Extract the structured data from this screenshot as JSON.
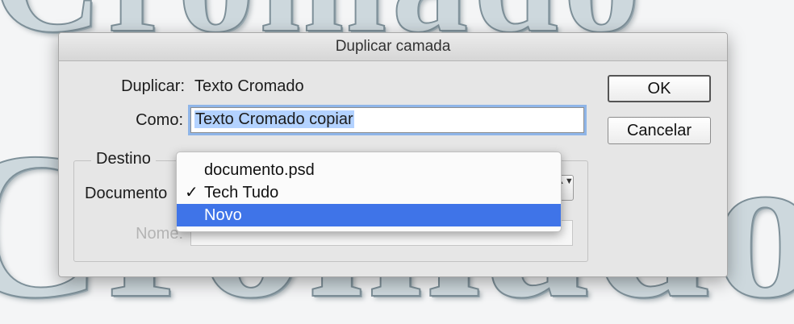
{
  "background": {
    "word_top": "Cromado",
    "word_bottom": "Cromado"
  },
  "dialog": {
    "title": "Duplicar camada",
    "duplicar_label": "Duplicar:",
    "duplicar_value": "Texto Cromado",
    "como_label": "Como:",
    "como_value": "Texto Cromado copiar",
    "ok_label": "OK",
    "cancel_label": "Cancelar",
    "group_title": "Destino",
    "documento_label": "Documento",
    "nome_label": "Nome:"
  },
  "menu": {
    "items": [
      {
        "label": "documento.psd",
        "checked": false,
        "highlighted": false
      },
      {
        "label": "Tech Tudo",
        "checked": true,
        "highlighted": false
      },
      {
        "label": "Novo",
        "checked": false,
        "highlighted": true
      }
    ],
    "check_glyph": "✓",
    "highlight_color": "#3f74e8"
  },
  "icons": {
    "select_arrows": "▲▼"
  }
}
